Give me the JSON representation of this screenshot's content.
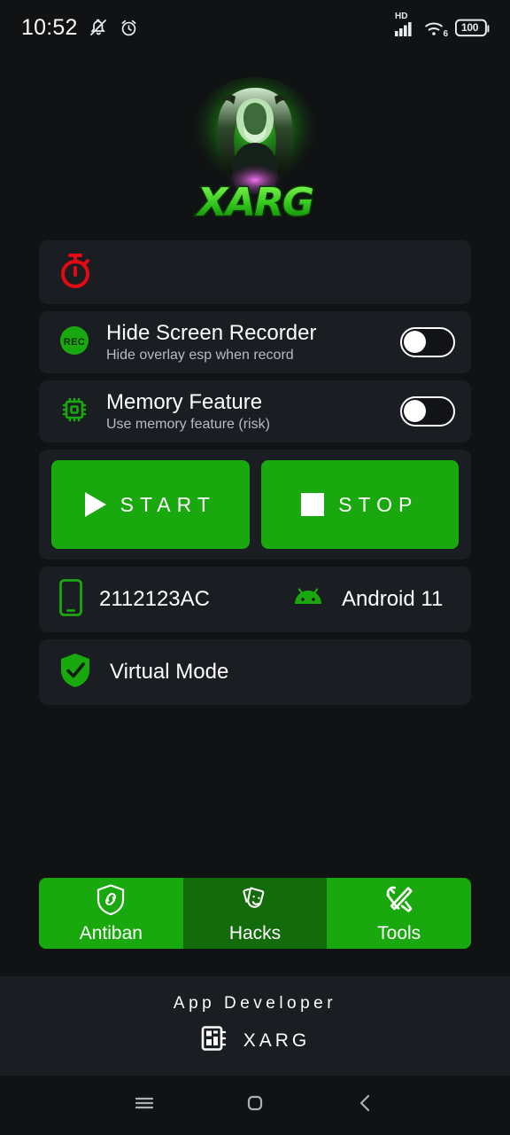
{
  "status_bar": {
    "time": "10:52",
    "icons_left": [
      "bell-mute-icon",
      "alarm-clock-icon"
    ],
    "network_label": "HD",
    "wifi_label": "6",
    "battery_level": "100"
  },
  "logo": {
    "brand_text": "XARG",
    "alt": "xarg-predator-logo",
    "glow_color": "#37d62a"
  },
  "timer_card": {
    "icon": "stopwatch-icon",
    "icon_color": "#e50914",
    "value": ""
  },
  "settings": [
    {
      "icon": "rec-icon",
      "title": "Hide Screen Recorder",
      "subtitle": "Hide overlay esp when record",
      "toggle_state": "off"
    },
    {
      "icon": "cpu-chip-icon",
      "title": "Memory Feature",
      "subtitle": "Use memory feature (risk)",
      "toggle_state": "off"
    }
  ],
  "actions": {
    "start_label": "START",
    "stop_label": "STOP",
    "button_color": "#19a80d"
  },
  "device": {
    "phone_icon": "smartphone-icon",
    "model": "2112123AC",
    "os_icon": "android-icon",
    "os_version": "Android 11"
  },
  "virtual_mode": {
    "icon": "shield-check-icon",
    "label": "Virtual Mode"
  },
  "tabs": [
    {
      "label": "Antiban",
      "icon": "shield-link-icon",
      "active": true
    },
    {
      "label": "Hacks",
      "icon": "theater-masks-icon",
      "active": false
    },
    {
      "label": "Tools",
      "icon": "tools-icon",
      "active": true
    }
  ],
  "footer": {
    "title": "App Developer",
    "icon": "memory-chip-icon",
    "developer": "XARG"
  },
  "nav_bar": {
    "recents_icon": "menu-icon",
    "home_icon": "home-square-icon",
    "back_icon": "back-chevron-icon"
  }
}
